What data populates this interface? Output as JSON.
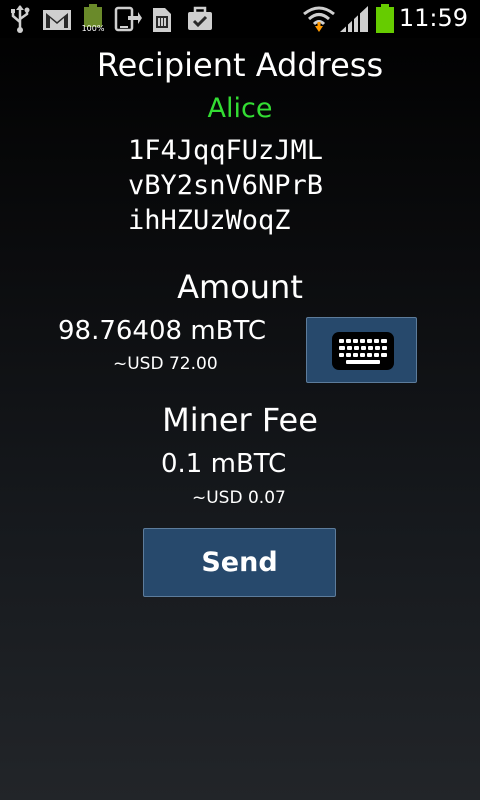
{
  "status_bar": {
    "time": "11:59",
    "battery_percent_label": "100%",
    "icons": [
      "usb-icon",
      "gmail-icon",
      "battery-full-icon",
      "download-icon",
      "sd-card-icon",
      "briefcase-check-icon",
      "wifi-icon",
      "signal-icon",
      "battery-icon"
    ]
  },
  "recipient": {
    "title": "Recipient Address",
    "name": "Alice",
    "address_lines": [
      "1F4JqqFUzJML",
      "vBY2snV6NPrB",
      "ihHZUzWoqZ"
    ]
  },
  "amount": {
    "title": "Amount",
    "value": "98.76408 mBTC",
    "usd": "~USD 72.00",
    "keyboard_icon": "keyboard-icon"
  },
  "miner_fee": {
    "title": "Miner Fee",
    "value": "0.1 mBTC",
    "usd": "~USD 0.07"
  },
  "actions": {
    "send_label": "Send"
  },
  "colors": {
    "recipient_name": "#33dd33",
    "button_bg": "#27496c",
    "button_border": "#5d7c9b",
    "battery_green": "#66cc00",
    "wifi_arrow": "#ff9900"
  }
}
